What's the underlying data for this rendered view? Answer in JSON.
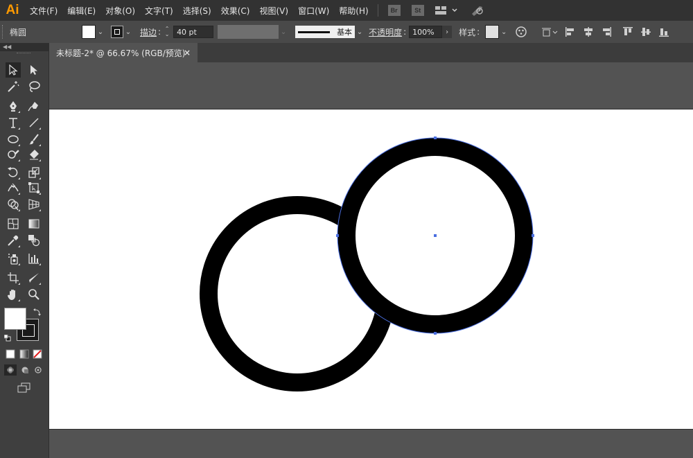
{
  "app": {
    "logo": "Ai"
  },
  "menu": {
    "items": [
      "文件(F)",
      "编辑(E)",
      "对象(O)",
      "文字(T)",
      "选择(S)",
      "效果(C)",
      "视图(V)",
      "窗口(W)",
      "帮助(H)"
    ],
    "bridge_badge": "Br",
    "stock_badge": "St"
  },
  "control": {
    "object_type": "椭圆",
    "stroke_label": "描边",
    "stroke_weight": "40 pt",
    "stroke_style": "基本",
    "opacity_label": "不透明度",
    "opacity_value": "100%",
    "style_label": "样式",
    "colon": ":"
  },
  "document": {
    "tab_title": "未标题-2* @ 66.67% (RGB/预览)",
    "close_glyph": "×"
  },
  "artwork": {
    "stroke_color": "#000000",
    "fill_color": "#ffffff",
    "selection_color": "#4a6ee0"
  },
  "colors": {
    "menubar_bg": "#323232",
    "controlbar_bg": "#494949",
    "workspace_bg": "#535353",
    "logo": "#ff9a00"
  }
}
